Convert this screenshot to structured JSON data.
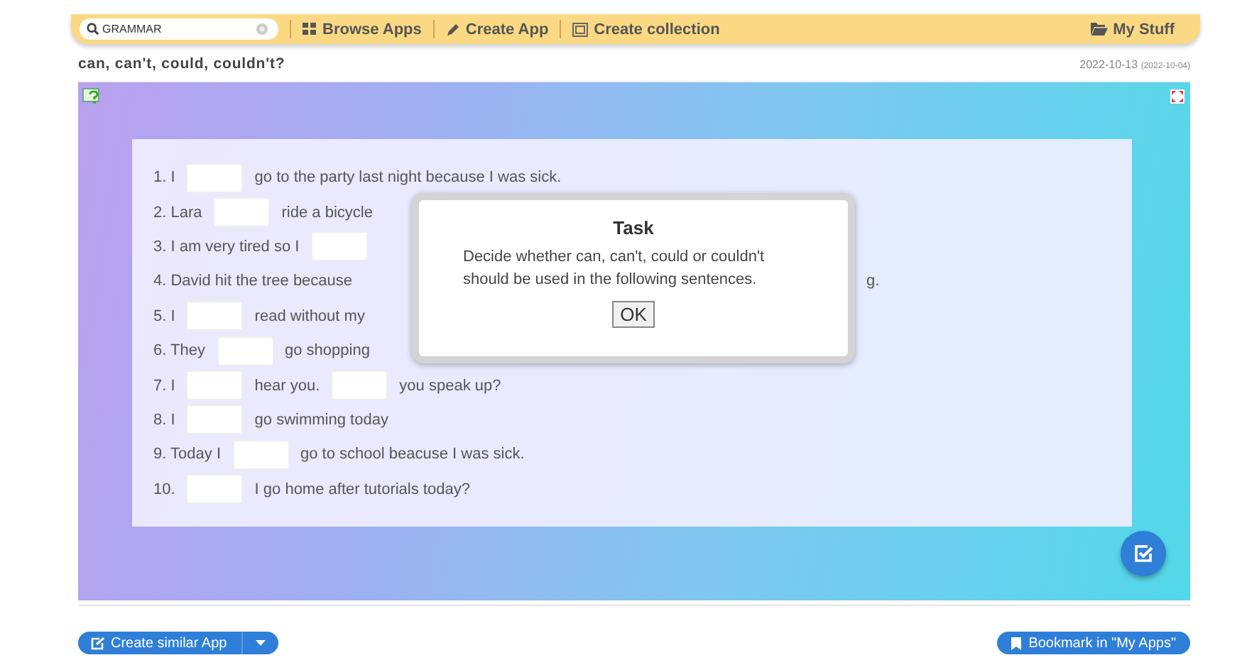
{
  "nav": {
    "search": {
      "value": "GRAMMAR"
    },
    "links": [
      {
        "kind": "browse",
        "label": "Browse Apps"
      },
      {
        "kind": "create",
        "label": "Create App"
      },
      {
        "kind": "collection",
        "label": "Create collection"
      }
    ],
    "my_stuff": "My Stuff"
  },
  "title": "can, can't, could, couldn't?",
  "date": "2022-10-13",
  "date_original": "(2022-10-04)",
  "exercise": {
    "rows": [
      {
        "parts": [
          {
            "kind": "text",
            "text": "1. I"
          },
          {
            "kind": "blank"
          },
          {
            "kind": "text",
            "text": "go to the party last night because I was sick."
          }
        ]
      },
      {
        "parts": [
          {
            "kind": "text",
            "text": "2. Lara"
          },
          {
            "kind": "blank"
          },
          {
            "kind": "text",
            "text": "ride a bicycle"
          }
        ]
      },
      {
        "parts": [
          {
            "kind": "text",
            "text": "3. I am very tired so I"
          },
          {
            "kind": "blank"
          }
        ]
      },
      {
        "parts": [
          {
            "kind": "text",
            "text": "4. David hit the tree because"
          },
          {
            "kind": "covered"
          },
          {
            "kind": "text",
            "text": "g."
          }
        ]
      },
      {
        "parts": [
          {
            "kind": "text",
            "text": "5. I"
          },
          {
            "kind": "blank"
          },
          {
            "kind": "text",
            "text": "read without my"
          }
        ]
      },
      {
        "parts": [
          {
            "kind": "text",
            "text": "6. They"
          },
          {
            "kind": "blank"
          },
          {
            "kind": "text",
            "text": "go shopping"
          }
        ]
      },
      {
        "parts": [
          {
            "kind": "text",
            "text": "7. I"
          },
          {
            "kind": "blank"
          },
          {
            "kind": "text",
            "text": "hear you."
          },
          {
            "kind": "blank"
          },
          {
            "kind": "text",
            "text": "you speak up?"
          }
        ]
      },
      {
        "parts": [
          {
            "kind": "text",
            "text": "8. I"
          },
          {
            "kind": "blank"
          },
          {
            "kind": "text",
            "text": "go swimming today"
          }
        ]
      },
      {
        "parts": [
          {
            "kind": "text",
            "text": "9. Today I"
          },
          {
            "kind": "blank"
          },
          {
            "kind": "text",
            "text": "go to school beacuse I was sick."
          }
        ]
      },
      {
        "parts": [
          {
            "kind": "text",
            "text": "10."
          },
          {
            "kind": "blank"
          },
          {
            "kind": "text",
            "text": "I go home after tutorials today?"
          }
        ]
      }
    ]
  },
  "dialog": {
    "title": "Task",
    "message": "Decide whether can, can't, could or couldn't should be used in the following sentences.",
    "button": "OK"
  },
  "footer": {
    "create_similar": "Create similar App",
    "bookmark": "Bookmark in \"My Apps\""
  }
}
